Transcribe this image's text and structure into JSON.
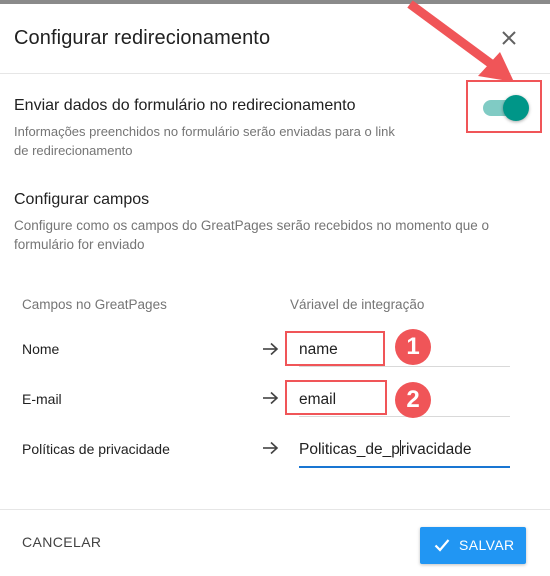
{
  "dialog": {
    "title": "Configurar redirecionamento",
    "close_icon": "close-icon"
  },
  "send_data": {
    "title": "Enviar dados do formulário no redirecionamento",
    "description_line1": "Informações preenchidos no formulário serão enviadas para o link",
    "description_line2": "de redirecionamento",
    "toggle_on": true,
    "toggle_color": "#009688"
  },
  "fields_section": {
    "title": "Configurar campos",
    "description_line1": "Configure como os campos do GreatPages serão recebidos no momento que o",
    "description_line2": "formulário for enviado",
    "col_left": "Campos no GreatPages",
    "col_right": "Váriavel de integração",
    "rows": [
      {
        "label": "Nome",
        "value": "name"
      },
      {
        "label": "E-mail",
        "value": "email"
      },
      {
        "label": "Políticas de privacidade",
        "value_before_caret": "Politicas_de_p",
        "value_after_caret": "rivacidade"
      }
    ]
  },
  "annotations": {
    "badge_1": "1",
    "badge_2": "2",
    "highlight_color": "#f05558"
  },
  "footer": {
    "cancel_label": "CANCELAR",
    "save_label": "SALVAR",
    "save_color": "#2196f3"
  }
}
